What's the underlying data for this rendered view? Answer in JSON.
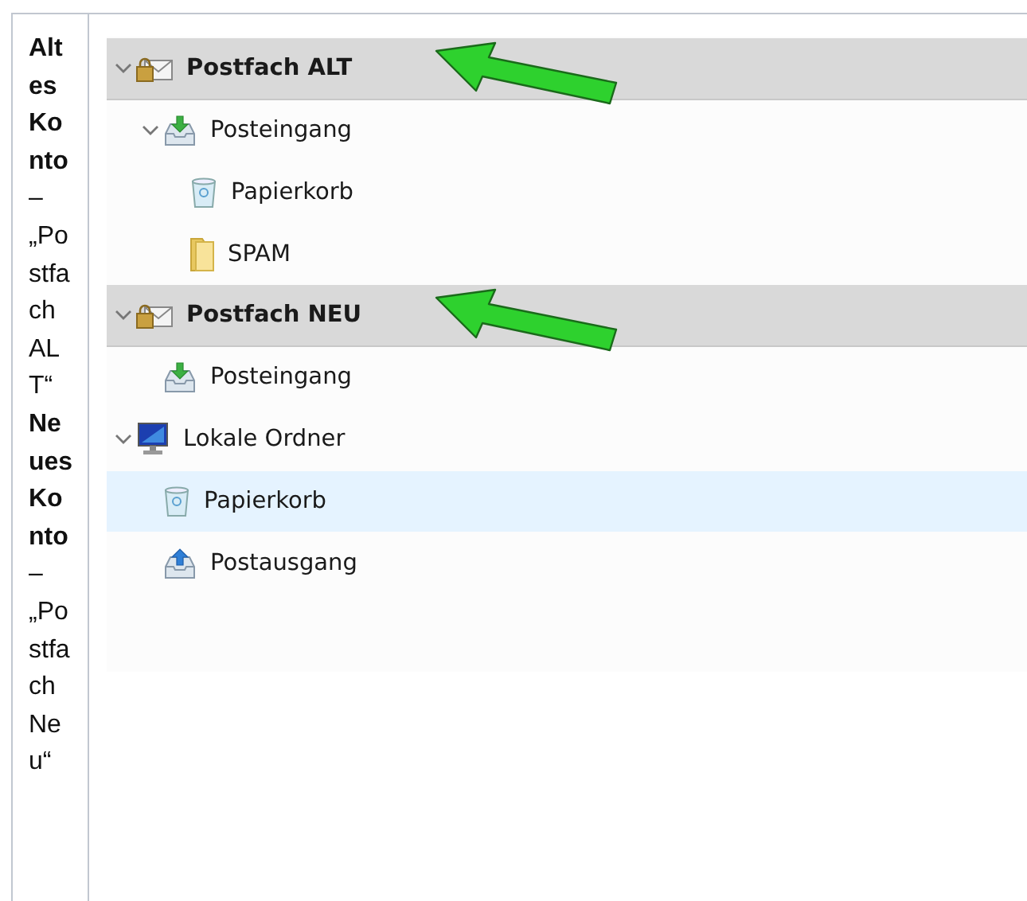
{
  "caption": "**Altes Konto** – „Postfach ALT“ **Neues Konto** – „Postfach Neu“",
  "folders": [
    {
      "label": "Postfach ALT",
      "kind": "account",
      "expanded": true,
      "selected": false,
      "arrow": true,
      "children": [
        {
          "label": "Posteingang",
          "kind": "inbox",
          "expanded": true,
          "selected": false,
          "arrow": false,
          "children": [
            {
              "label": "Papierkorb",
              "kind": "trash",
              "selected": false,
              "arrow": false
            },
            {
              "label": "SPAM",
              "kind": "folder",
              "selected": false,
              "arrow": false
            }
          ]
        }
      ]
    },
    {
      "label": "Postfach NEU",
      "kind": "account",
      "expanded": true,
      "selected": false,
      "arrow": true,
      "children": [
        {
          "label": "Posteingang",
          "kind": "inbox",
          "selected": false,
          "arrow": false
        }
      ]
    },
    {
      "label": "Lokale Ordner",
      "kind": "local",
      "expanded": true,
      "selected": false,
      "arrow": false,
      "children": [
        {
          "label": "Papierkorb",
          "kind": "trash",
          "selected": true,
          "arrow": false
        },
        {
          "label": "Postausgang",
          "kind": "outbox",
          "selected": false,
          "arrow": false
        }
      ]
    }
  ]
}
